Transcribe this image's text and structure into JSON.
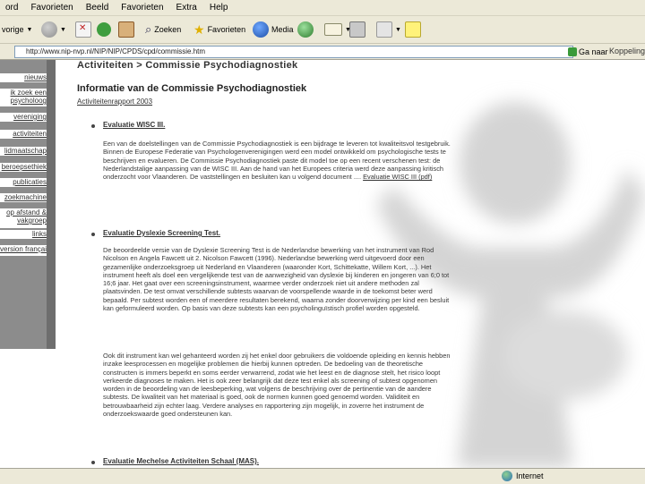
{
  "menu": [
    "ord",
    "Favorieten",
    "Beeld",
    "Favorieten",
    "Extra",
    "Help"
  ],
  "toolbar": {
    "back_label": "vorige",
    "search_label": "Zoeken",
    "favorites_label": "Favorieten",
    "media_label": "Media"
  },
  "address": {
    "url": "http://www.nip-nvp.nl/NIP/NIP/CPDS/cpd/commissie.htm",
    "go_label": "Ga naar",
    "links_label": "Koppelingen"
  },
  "sidebar": {
    "items": [
      "nieuws",
      "ik zoek een psycholoog",
      "vereniging",
      "activiteiten",
      "lidmaatschap",
      "beroepsethiek",
      "publicaties",
      "zoekmachine",
      "op afstand & vakgroep",
      "links"
    ],
    "bottom_item": "version française"
  },
  "content": {
    "site_title": "Activiteiten > Commissie Psychodiagnostiek",
    "page_title": "Informatie van de Commissie Psychodiagnostiek",
    "report_link": "Activiteitenrapport 2003",
    "sections": [
      {
        "title": "Evaluatie WISC III.",
        "paragraphs": [
          "Een van de doelstellingen van de Commissie Psychodiagnostiek is een bijdrage te leveren tot kwaliteitsvol testgebruik. Binnen de Europese Federatie van Psychologenverenigingen werd een model ontwikkeld om psychologische tests te beschrijven en evalueren. De Commissie Psychodiagnostiek paste dit model toe op een recent verschenen test: de Nederlandstalige aanpassing van de WISC III. Aan de hand van het Europees criteria werd deze aanpassing kritisch onderzocht voor Vlaanderen. De vaststellingen en besluiten kan u volgend document",
          "...."
        ],
        "link": "Evaluatie WISC III (pdf)"
      },
      {
        "title": "Evaluatie Dyslexie Screening Test.",
        "paragraphs": [
          "De beoordeelde versie van de Dyslexie Screening Test is de Nederlandse bewerking van het instrument van Rod Nicolson en Angela Fawcett uit 2. Nicolson Fawcett (1996). Nederlandse bewerking werd uitgevoerd door een gezamenlijke onderzoeksgroep uit Nederland en Vlaanderen (waaronder Kort, Schittekatte, Willem Kort, ...). Het instrument heeft als doel een vergelijkende test van de aanwezigheid van dyslexie bij kinderen en jongeren van 6;0 tot 16;6 jaar. Het gaat over een screeningsinstrument, waarmee verder onderzoek niet uit andere methoden zal plaatsvinden. De test omvat verschillende subtests waarvan de voorspellende waarde in de toekomst beter werd bepaald. Per subtest worden een of meerdere resultaten berekend, waarna zonder doorverwijzing per kind een besluit kan geformuleerd worden. Op basis van deze subtests kan een psycholinguïstisch profiel worden opgesteld.",
          "Ook dit instrument kan wel gehanteerd worden zij het enkel door gebruikers die voldoende opleiding en kennis hebben inzake leesprocessen en mogelijke problemen die hierbij kunnen optreden. De bedoeling van de theoretische constructen is immers beperkt en soms eerder verwarrend, zodat wie het leest en de diagnose stelt, het risico loopt verkeerde diagnoses te maken. Het is ook zeer belangrijk dat deze test enkel als screening of subtest opgenomen worden in de beoordeling van de leesbeperking, wat volgens de beschrijving over de pertinentie van de aandere subtests. De kwaliteit van het materiaal is goed, ook de normen kunnen goed genoemd worden. Validiteit en betrouwbaarheid zijn echter laag. Verdere analyses en rapportering zijn mogelijk, in zoverre het instrument de onderzoekswaarde goed ondersteunen kan."
        ]
      },
      {
        "title": "Evaluatie Mechelse Activiteiten Schaal (MAS)."
      }
    ]
  },
  "status": {
    "zone": "Internet"
  },
  "colors": {
    "chrome": "#ece9d8",
    "sidebar": "#8c8c8c",
    "text": "#333333"
  }
}
